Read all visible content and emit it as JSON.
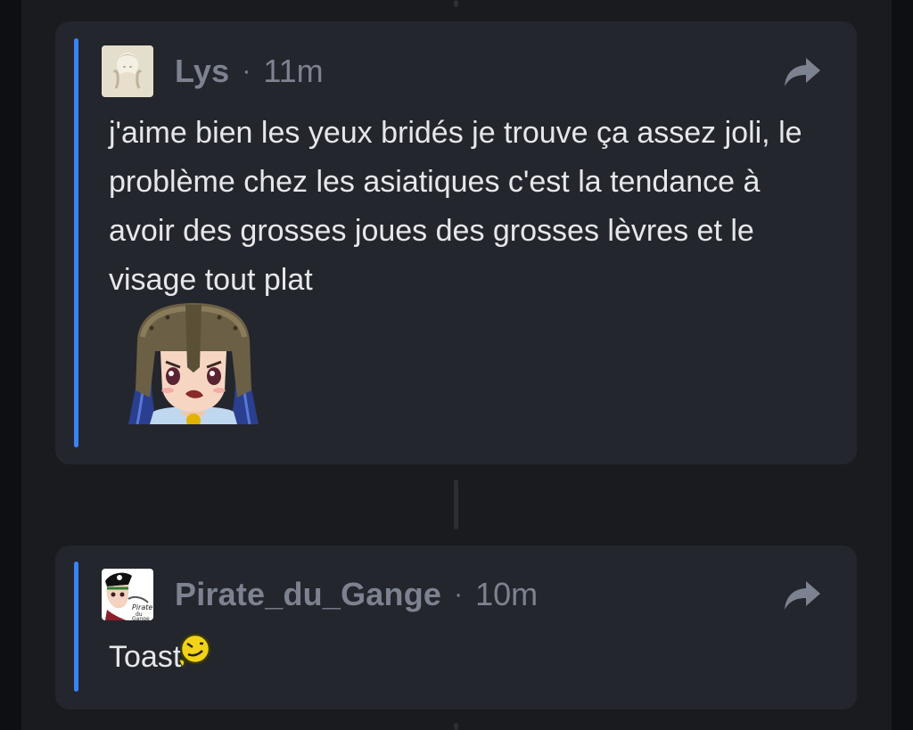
{
  "posts": [
    {
      "author": "Lys",
      "separator": "·",
      "time": "11m",
      "text": "j'aime bien les yeux bridés je trouve ça assez joli, le problème chez les asiatiques c'est la tendance à avoir des grosses joues des grosses lèvres et le visage tout plat",
      "share_icon": "share-arrow-icon",
      "attachment": "helmet-girl-sticker"
    },
    {
      "author": "Pirate_du_Gange",
      "separator": "·",
      "time": "10m",
      "text": "Toast",
      "share_icon": "share-arrow-icon",
      "emoji": "squinting-smiley-emoji"
    }
  ],
  "colors": {
    "background": "#0e0f12",
    "column": "#1a1b1f",
    "card": "#24262d",
    "accent": "#3b82f6",
    "meta_text": "#7d8290",
    "body_text": "#e6e7ea"
  }
}
